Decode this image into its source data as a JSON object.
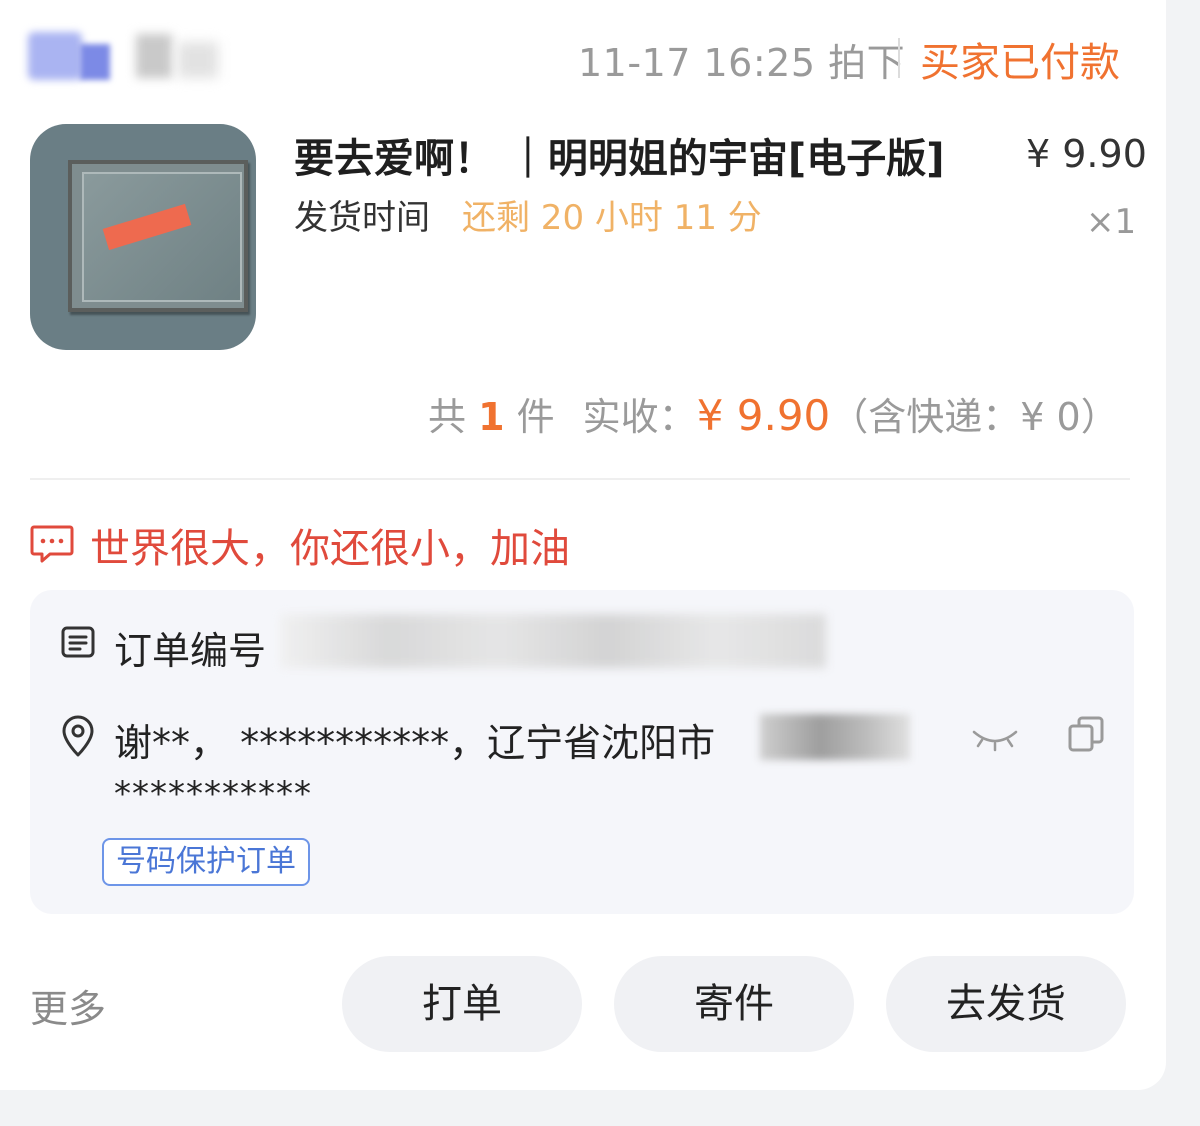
{
  "header": {
    "time": "11-17 16:25 拍下",
    "status": "买家已付款"
  },
  "product": {
    "title": "要去爱啊！ ｜明明姐的宇宙[电子版]",
    "price": "¥ 9.90",
    "ship_label": "发货时间",
    "ship_remaining": "还剩 20 小时 11 分",
    "qty": "×1",
    "thumbnail_icon": "framed-artwork-image"
  },
  "totals": {
    "prefix": "共",
    "count": "1",
    "unit": "件",
    "received_label": "实收：",
    "received_amount": "¥ 9.90",
    "shipping_note": "（含快递：¥ 0）"
  },
  "note": {
    "icon": "chat-bubble-icon",
    "text": "世界很大，你还很小，加油"
  },
  "info": {
    "order_label": "订单编号",
    "address_line1": "谢**， ***********，辽宁省沈阳市",
    "address_line2": "***********",
    "badge": "号码保护订单"
  },
  "footer": {
    "more": "更多",
    "print": "打单",
    "send": "寄件",
    "ship": "去发货"
  },
  "colors": {
    "accent": "#f07230",
    "note": "#e04a3c",
    "remaining": "#f0b266",
    "badge": "#4a76d6"
  }
}
